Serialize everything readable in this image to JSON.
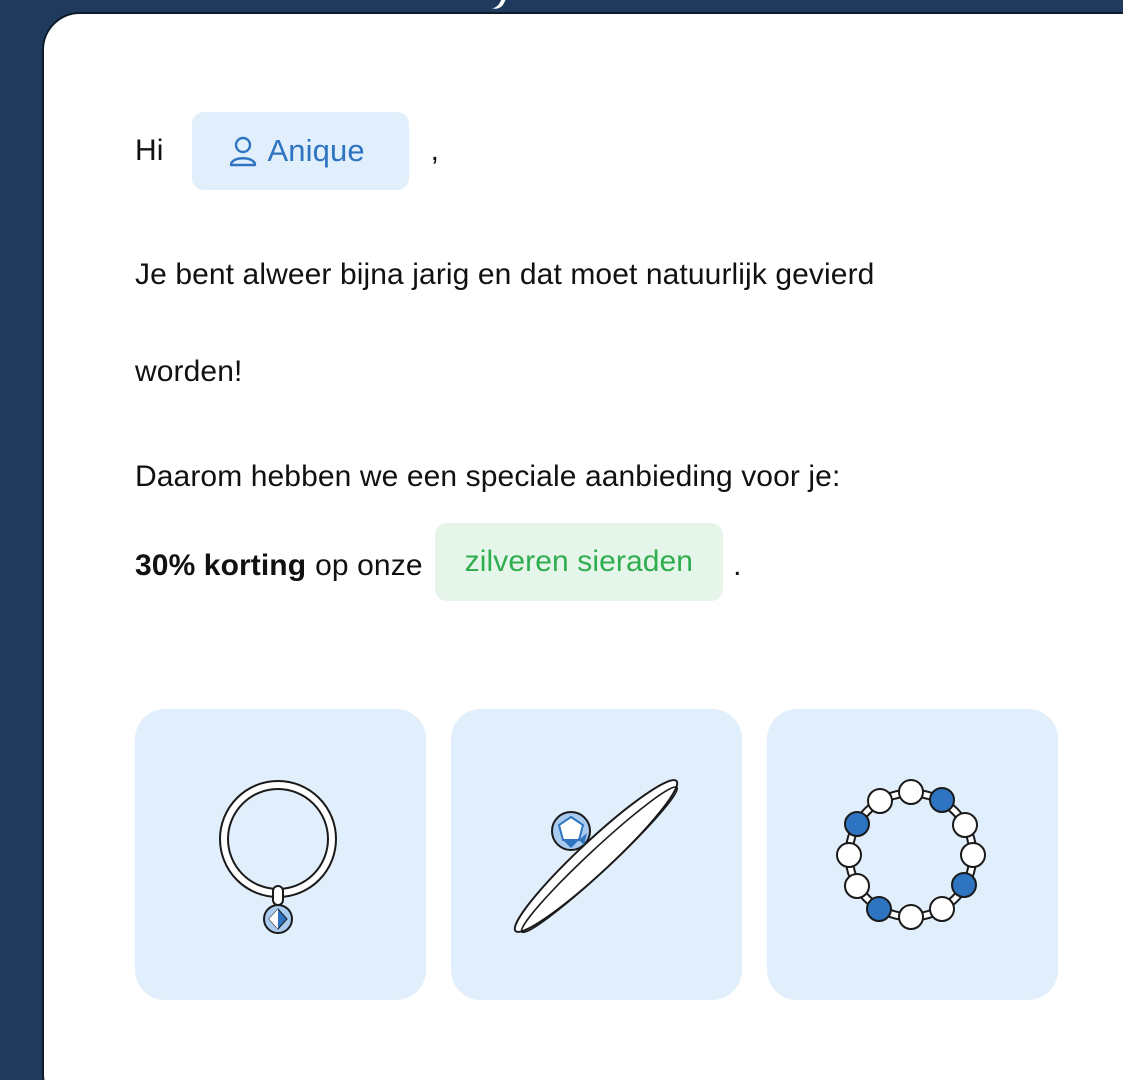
{
  "email": {
    "greeting": "Hi",
    "recipient_name": "Anique",
    "comma": ",",
    "paragraph_1_line_1": "Je bent alweer bijna jarig en dat moet natuurlijk gevierd",
    "paragraph_1_line_2": "worden!",
    "paragraph_2": "Daarom hebben we een speciale aanbieding voor je:",
    "offer_bold": "30% korting",
    "offer_text": "op onze",
    "offer_link": "zilveren sieraden",
    "period": "."
  },
  "products": [
    {
      "name": "ring-with-pendant",
      "icon": "pendant-ring-icon"
    },
    {
      "name": "bracelet-with-gem",
      "icon": "gem-bangle-icon"
    },
    {
      "name": "bead-bracelet",
      "icon": "bead-bracelet-icon"
    }
  ],
  "colors": {
    "background": "#1f3a5c",
    "card": "#ffffff",
    "chip_blue_bg": "#e1eefb",
    "chip_blue_text": "#2f74c0",
    "chip_green_bg": "#e6f5ea",
    "chip_green_text": "#2fae4f",
    "accent_blue": "#2f74c0"
  }
}
